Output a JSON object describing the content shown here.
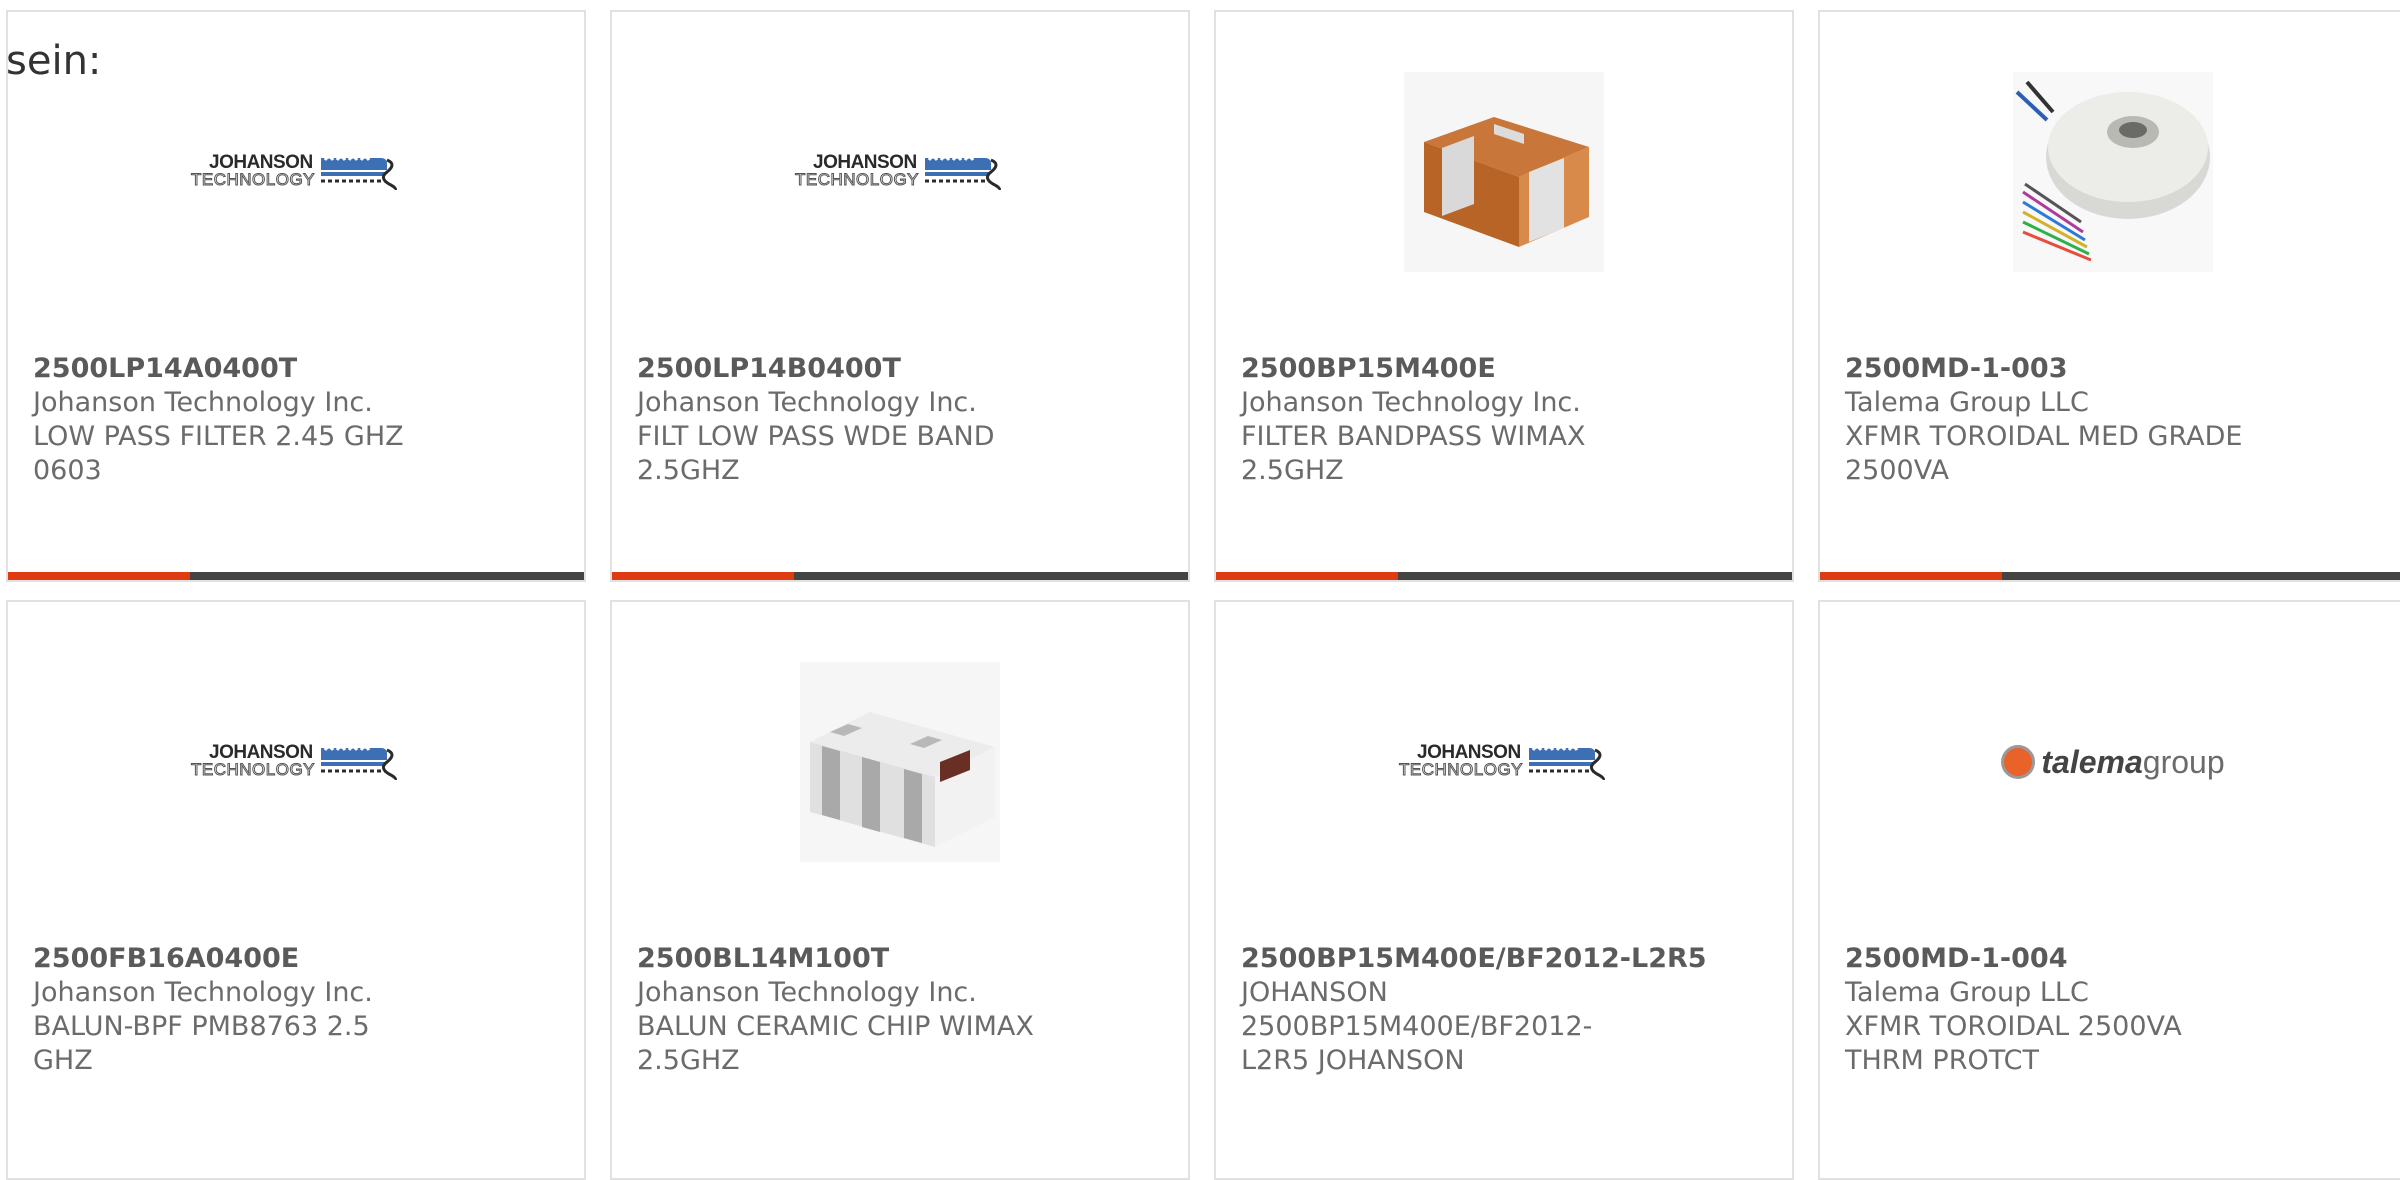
{
  "intro_text": "sein:",
  "accent_color": "#e03a12",
  "bar_color": "#444444",
  "products": [
    {
      "part": "2500LP14A0400T",
      "maker": "Johanson Technology Inc.",
      "desc": "LOW PASS FILTER 2.45 GHZ 0603",
      "image": "johanson-logo"
    },
    {
      "part": "2500LP14B0400T",
      "maker": "Johanson Technology Inc.",
      "desc": "FILT LOW PASS WDE BAND 2.5GHZ",
      "image": "johanson-logo"
    },
    {
      "part": "2500BP15M400E",
      "maker": "Johanson Technology Inc.",
      "desc": "FILTER BANDPASS WIMAX 2.5GHZ",
      "image": "chip-component-photo"
    },
    {
      "part": "2500MD-1-003",
      "maker": "Talema Group LLC",
      "desc": "XFMR TOROIDAL MED GRADE 2500VA",
      "image": "toroidal-transformer-photo"
    },
    {
      "part": "2500FB16A0400E",
      "maker": "Johanson Technology Inc.",
      "desc": "BALUN-BPF PMB8763 2.5 GHZ",
      "image": "johanson-logo"
    },
    {
      "part": "2500BL14M100T",
      "maker": "Johanson Technology Inc.",
      "desc": "BALUN CERAMIC CHIP WIMAX 2.5GHZ",
      "image": "ceramic-balun-photo"
    },
    {
      "part": "2500BP15M400E/BF2012-L2R5",
      "maker": "JOHANSON",
      "desc": "2500BP15M400E/BF2012-L2R5 JOHANSON",
      "image": "johanson-logo"
    },
    {
      "part": "2500MD-1-004",
      "maker": "Talema Group LLC",
      "desc": "XFMR TOROIDAL 2500VA THRM PROTCT",
      "image": "talema-logo"
    }
  ],
  "logos": {
    "johanson_line1": "JOHANSON",
    "johanson_line2": "TECHNOLOGY",
    "talema_bold": "talema",
    "talema_light": "group"
  }
}
